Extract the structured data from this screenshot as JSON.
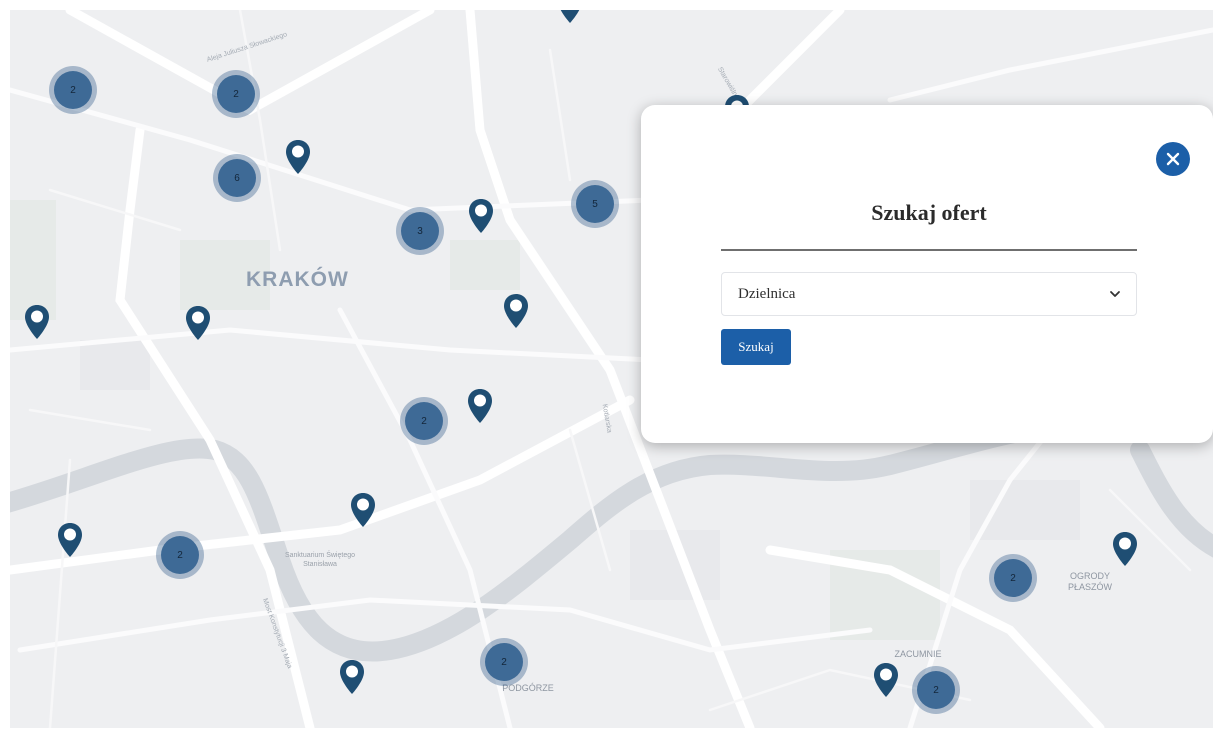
{
  "map": {
    "city_label": "KRAKÓW",
    "district_labels": [
      "PODGÓRZE",
      "ZACUMNIE",
      "OGRODY PŁASZÓW"
    ],
    "poi_labels": [
      "Sanktuarium Świętego Stanisława"
    ],
    "street_labels": [
      "Aleja Juliusza Słowackiego",
      "Starowiślna",
      "Kotlarska",
      "Most Konstytucji 3 Maja"
    ],
    "cluster_counts": [
      "2",
      "2",
      "6",
      "3",
      "5",
      "2",
      "2",
      "2",
      "2",
      "2"
    ],
    "pin_icon": "map-pin-icon",
    "colors": {
      "cluster": "#3e6a96",
      "pin": "#1f4e73",
      "accent": "#1c5fa8"
    }
  },
  "search": {
    "title": "Szukaj ofert",
    "select_value": "Dzielnica",
    "button_label": "Szukaj",
    "close_icon": "close-icon"
  }
}
